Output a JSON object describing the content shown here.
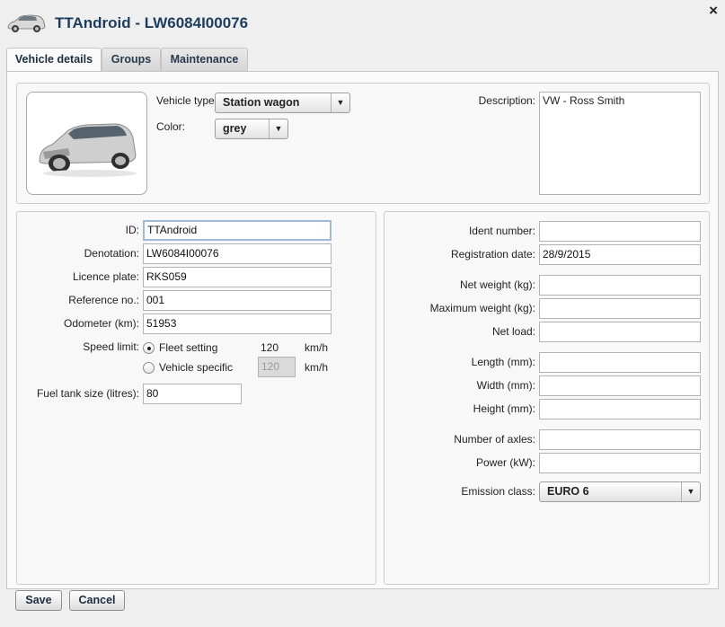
{
  "window": {
    "title": "TTAndroid - LW6084I00076",
    "close_symbol": "×"
  },
  "tabs": [
    {
      "label": "Vehicle details",
      "active": true
    },
    {
      "label": "Groups",
      "active": false
    },
    {
      "label": "Maintenance",
      "active": false
    }
  ],
  "vehicle": {
    "type_label": "Vehicle type:",
    "type_value": "Station wagon",
    "color_label": "Color:",
    "color_value": "grey",
    "description_label": "Description:",
    "description_value": "VW - Ross Smith"
  },
  "left_form": {
    "id": {
      "label": "ID:",
      "value": "TTAndroid"
    },
    "denotation": {
      "label": "Denotation:",
      "value": "LW6084I00076"
    },
    "licence_plate": {
      "label": "Licence plate:",
      "value": "RKS059"
    },
    "reference_no": {
      "label": "Reference no.:",
      "value": "001"
    },
    "odometer": {
      "label": "Odometer (km):",
      "value": "51953"
    },
    "speed_limit": {
      "label": "Speed limit:",
      "fleet_setting_label": "Fleet setting",
      "fleet_setting_value": "120",
      "vehicle_specific_label": "Vehicle specific",
      "vehicle_specific_value": "120",
      "unit": "km/h",
      "selected": "fleet_setting"
    },
    "fuel_tank": {
      "label": "Fuel tank size (litres):",
      "value": "80"
    }
  },
  "right_form": {
    "ident_number": {
      "label": "Ident number:",
      "value": ""
    },
    "registration_date": {
      "label": "Registration date:",
      "value": "28/9/2015"
    },
    "net_weight": {
      "label": "Net weight (kg):",
      "value": ""
    },
    "max_weight": {
      "label": "Maximum weight (kg):",
      "value": ""
    },
    "net_load": {
      "label": "Net load:",
      "value": ""
    },
    "length": {
      "label": "Length (mm):",
      "value": ""
    },
    "width": {
      "label": "Width (mm):",
      "value": ""
    },
    "height": {
      "label": "Height (mm):",
      "value": ""
    },
    "axles": {
      "label": "Number of axles:",
      "value": ""
    },
    "power": {
      "label": "Power (kW):",
      "value": ""
    },
    "emission": {
      "label": "Emission class:",
      "value": "EURO 6"
    }
  },
  "footer": {
    "save_label": "Save",
    "cancel_label": "Cancel"
  },
  "icons": {
    "car": "car-icon",
    "dropdown": "▼"
  }
}
